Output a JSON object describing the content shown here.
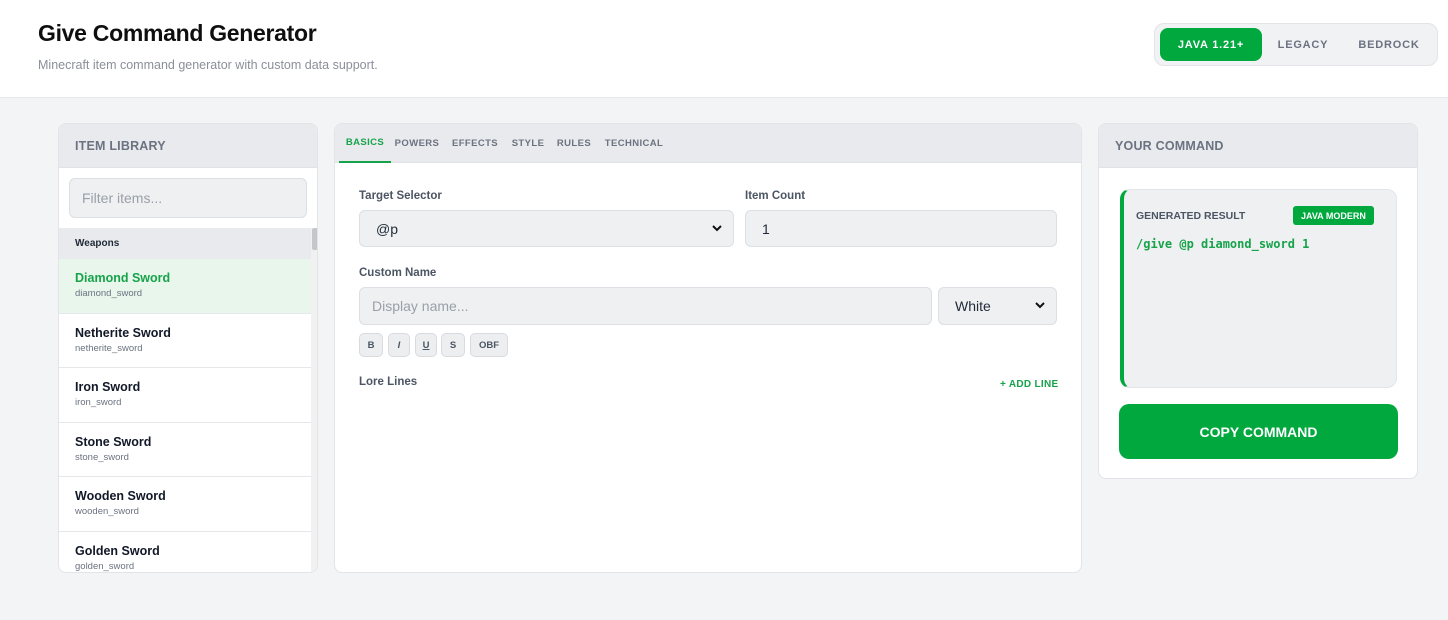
{
  "header": {
    "title": "Give Command Generator",
    "subtitle": "Minecraft item command generator with custom data support.",
    "versions": [
      "JAVA 1.21+",
      "LEGACY",
      "BEDROCK"
    ],
    "active_version": "JAVA 1.21+"
  },
  "library": {
    "title": "ITEM LIBRARY",
    "filter_placeholder": "Filter items...",
    "group": "Weapons",
    "items": [
      {
        "name": "Diamond Sword",
        "id": "diamond_sword",
        "selected": true
      },
      {
        "name": "Netherite Sword",
        "id": "netherite_sword"
      },
      {
        "name": "Iron Sword",
        "id": "iron_sword"
      },
      {
        "name": "Stone Sword",
        "id": "stone_sword"
      },
      {
        "name": "Wooden Sword",
        "id": "wooden_sword"
      },
      {
        "name": "Golden Sword",
        "id": "golden_sword"
      }
    ]
  },
  "editor": {
    "tabs": [
      "BASICS",
      "POWERS",
      "EFFECTS",
      "STYLE",
      "RULES",
      "TECHNICAL"
    ],
    "active_tab": "BASICS",
    "target_selector_label": "Target Selector",
    "target_selector_value": "@p",
    "item_count_label": "Item Count",
    "item_count_value": "1",
    "custom_name_label": "Custom Name",
    "custom_name_placeholder": "Display name...",
    "color_value": "White",
    "format_buttons": [
      "B",
      "I",
      "U",
      "S",
      "OBF"
    ],
    "lore_label": "Lore Lines",
    "add_line_label": "+ ADD LINE"
  },
  "command": {
    "title": "YOUR COMMAND",
    "result_label": "GENERATED RESULT",
    "badge": "JAVA MODERN",
    "text": "/give @p diamond_sword 1",
    "copy_label": "COPY COMMAND"
  },
  "colors": {
    "accent": "#00a83e",
    "accent_text": "#16a34a",
    "selected_bg": "#e8f6ec"
  }
}
